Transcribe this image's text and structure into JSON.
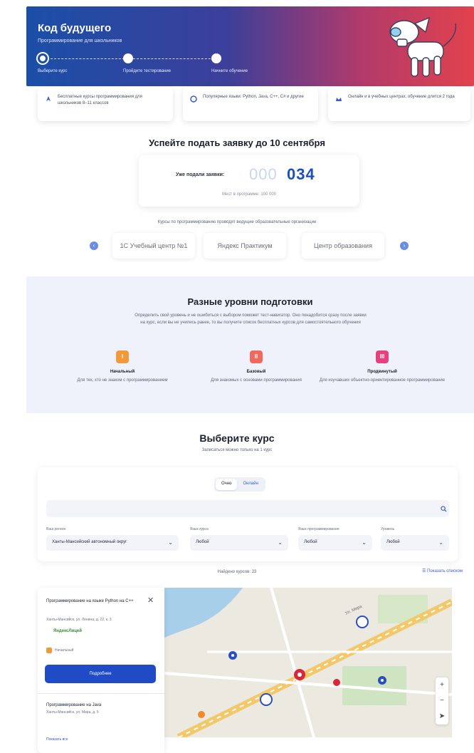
{
  "hero": {
    "title": "Код будущего",
    "subtitle": "Программирование для школьников",
    "steps": [
      {
        "label": "Выберите курс"
      },
      {
        "label": "Пройдите тестирование"
      },
      {
        "label": "Начните обучение"
      }
    ]
  },
  "features": [
    {
      "icon": "rocket-icon",
      "text": "Бесплатные курсы программирования для школьников 8–11 классов"
    },
    {
      "icon": "code-icon",
      "text": "Популярные языки: Python, Java, C++, C# и другие"
    },
    {
      "icon": "crown-icon",
      "text": "Онлайн и в учебных центрах, обучение длится 2 года"
    }
  ],
  "deadline": {
    "title": "Успейте подать заявку до 10 сентября",
    "counter_label": "Уже подали заявки:",
    "counter_zeros": "000",
    "counter_value": "034",
    "counter_note": "Мест в программе: 100 000"
  },
  "partners": {
    "caption": "Курсы по программированию проводят ведущие образовательные организации",
    "logos": [
      "1C Учебный центр №1",
      "Яндекс Практикум",
      "Центр образования"
    ],
    "prev": "‹",
    "next": "›"
  },
  "levels": {
    "title": "Разные уровни подготовки",
    "description": "Определить свой уровень и не ошибиться с выбором поможет тест-навигатор. Оно понадобится сразу после заявки на курс, если вы не учились ранее, то вы получите список бесплатных курсов для самостоятельного обучения",
    "items": [
      {
        "badge": "I",
        "name": "Начальный",
        "desc": "Для тех, кто не знаком с программированием",
        "color": "#f29a3a"
      },
      {
        "badge": "II",
        "name": "Базовый",
        "desc": "Для знакомых с основами программирования",
        "color": "#ef6a5c"
      },
      {
        "badge": "III",
        "name": "Продвинутый",
        "desc": "Для изучавших объектно-ориентированное программирование",
        "color": "#e8407e"
      }
    ]
  },
  "course": {
    "title": "Выберите курс",
    "subtitle": "Записаться можно только на 1 курс",
    "tabs": [
      "Очно",
      "Онлайн"
    ],
    "search_placeholder": "",
    "filters": [
      {
        "label": "Ваш регион",
        "value": "Ханты-Мансийский автономный округ"
      },
      {
        "label": "Язык курса",
        "value": "Любой"
      },
      {
        "label": "Язык программирования",
        "value": "Любой"
      },
      {
        "label": "Уровень",
        "value": "Любой"
      }
    ],
    "found": "Найдено курсов: 23",
    "list_toggle": "Показать списком"
  },
  "map_panel": {
    "title": "Программирование на языке Python на C++",
    "address": "Ханты-Мансийск, ул. Ленина, д. 22, к. 3",
    "org": "ЯндексЛицей",
    "level": "Начальный",
    "button": "Подробнее",
    "item2_title": "Программирование на Java",
    "item2_address": "Ханты-Мансийск, ул. Мира, д. 5",
    "more": "Показать все"
  },
  "map": {
    "street_label": "Ул. Мира",
    "zoom_in": "+",
    "zoom_out": "−",
    "locate": "➤"
  },
  "colors": {
    "primary": "#1f4bc7",
    "hero_left": "#1b4fa8",
    "hero_right": "#e2424d",
    "levels_bg": "#eff2fb"
  }
}
